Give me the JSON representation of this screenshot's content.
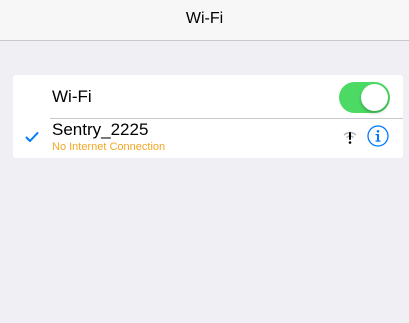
{
  "nav": {
    "title": "Wi-Fi"
  },
  "wifi_toggle": {
    "label": "Wi-Fi",
    "enabled": true,
    "on_color": "#4cd964"
  },
  "network": {
    "name": "Sentry_2225",
    "status": "No Internet Connection",
    "status_color": "#f5a623",
    "connected": true,
    "signal_icon": "wifi-warning-icon",
    "info_icon": "info-icon"
  },
  "colors": {
    "accent": "#007aff",
    "background": "#efeff4"
  }
}
